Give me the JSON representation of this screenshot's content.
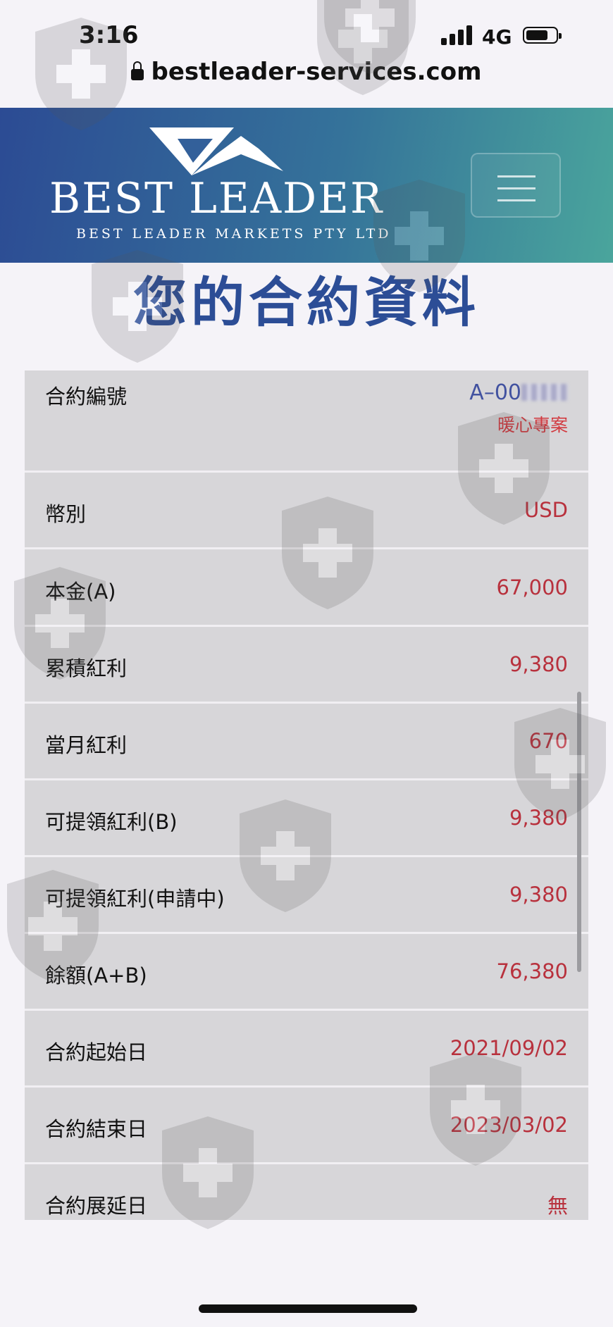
{
  "status_bar": {
    "time": "3:16",
    "network": "4G",
    "icons": [
      "signal-icon",
      "battery-icon"
    ]
  },
  "browser": {
    "url": "bestleader-services.com",
    "icon": "lock-icon"
  },
  "header": {
    "logo_text": "BEST LEADER",
    "logo_subtext": "BEST LEADER MARKETS PTY LTD",
    "menu_icon": "hamburger-menu-icon"
  },
  "page": {
    "title": "您的合約資料"
  },
  "contract": {
    "number_label": "合約編號",
    "number_value": "A–00",
    "number_note": "暖心專案",
    "rows": [
      {
        "label": "幣別",
        "value": "USD"
      },
      {
        "label": "本金(A)",
        "value": "67,000"
      },
      {
        "label": "累積紅利",
        "value": "9,380"
      },
      {
        "label": "當月紅利",
        "value": "670"
      },
      {
        "label": "可提領紅利(B)",
        "value": "9,380"
      },
      {
        "label": "可提領紅利(申請中)",
        "value": "9,380"
      },
      {
        "label": "餘額(A+B)",
        "value": "76,380"
      },
      {
        "label": "合約起始日",
        "value": "2021/09/02"
      },
      {
        "label": "合約結束日",
        "value": "2023/03/02"
      },
      {
        "label": "合約展延日",
        "value": "無"
      }
    ]
  },
  "colors": {
    "header_start": "#2c4b94",
    "header_end": "#4aa59c",
    "title": "#2c4d96",
    "value": "#b8313d",
    "note": "#d2393f",
    "contract_no": "#4252a0",
    "table_bg": "#d7d6d9"
  },
  "watermark_icon": "shield-cross-icon"
}
